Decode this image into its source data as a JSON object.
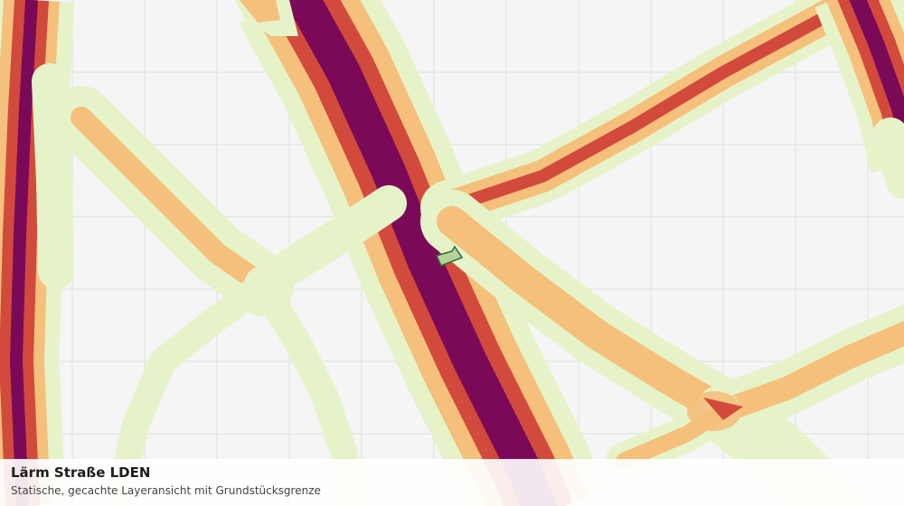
{
  "layer": {
    "title": "Lärm Straße LDEN",
    "subtitle": "Statische, gecachte Layeransicht mit Grundstücksgrenze"
  },
  "colors": {
    "background": "#f4f5f4",
    "grid": "#dde2dd",
    "noise_low": "#e6f3c9",
    "noise_mid": "#f4c07c",
    "noise_high": "#d24a3c",
    "noise_very_high": "#7a0a58",
    "parcel_fill": "#b4d39a",
    "parcel_stroke": "#2e6b3a"
  },
  "legend_levels": [
    "low",
    "mid",
    "high",
    "very_high"
  ]
}
